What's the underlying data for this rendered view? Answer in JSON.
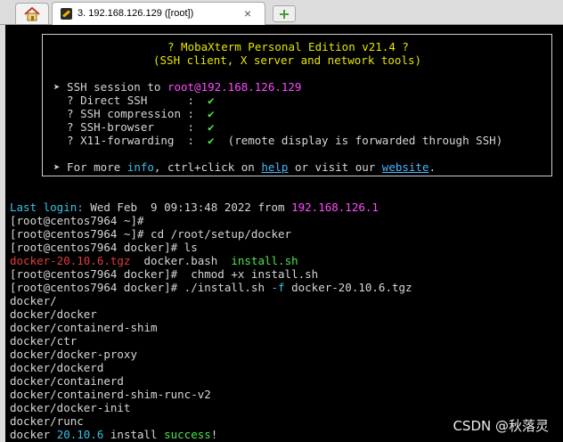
{
  "tabs": {
    "session_title": "3. 192.168.126.129 ([root])",
    "close_glyph": "×",
    "home_icon": "home-icon",
    "new_tab_icon": "new-tab-icon"
  },
  "banner": {
    "title": "? MobaXterm Personal Edition v21.4 ?",
    "subtitle": "(SSH client, X server and network tools)",
    "ssh_session_prefix": "➤ SSH session to ",
    "ssh_target": "root@192.168.126.129",
    "direct_ssh": "  ? Direct SSH      :  ",
    "ssh_compression": "  ? SSH compression :  ",
    "ssh_browser": "  ? SSH-browser     :  ",
    "x11_forwarding": "  ? X11-forwarding  :  ",
    "check": "✔",
    "x11_note": "  (remote display is forwarded through SSH)",
    "more_prefix": "➤ For more ",
    "more_info": "info",
    "more_mid": ", ctrl+click on ",
    "more_help": "help",
    "more_mid2": " or visit our ",
    "more_website": "website",
    "more_end": "."
  },
  "terminal": {
    "last_login_label": "Last login:",
    "last_login_time": " Wed Feb  9 09:13:48 2022 from ",
    "last_login_ip": "192.168.126.1",
    "l1": "[root@centos7964 ~]#",
    "l2": "[root@centos7964 ~]# cd /root/setup/docker",
    "l3": "[root@centos7964 docker]# ls",
    "ls_tgz": "docker-20.10.6.tgz",
    "ls_bash": "  docker.bash  ",
    "ls_sh": "install.sh",
    "l5": "[root@centos7964 docker]#  chmod +x install.sh",
    "l6_prompt": "[root@centos7964 docker]# ./install.sh ",
    "l6_flag": "-f",
    "l6_arg": " docker-20.10.6.tgz",
    "out": [
      "docker/",
      "docker/docker",
      "docker/containerd-shim",
      "docker/ctr",
      "docker/docker-proxy",
      "docker/dockerd",
      "docker/containerd",
      "docker/containerd-shim-runc-v2",
      "docker/docker-init",
      "docker/runc"
    ],
    "final_a": "docker ",
    "final_ver": "20.10.6",
    "final_b": " install ",
    "final_success": "success",
    "final_c": "!"
  },
  "watermark": "CSDN @秋落灵",
  "colors": {
    "background": "#000000",
    "yellow": "#e5e500",
    "magenta": "#ff4cff",
    "green": "#4ce64c",
    "cyan": "#39c1e6",
    "red": "#e03c3c"
  }
}
